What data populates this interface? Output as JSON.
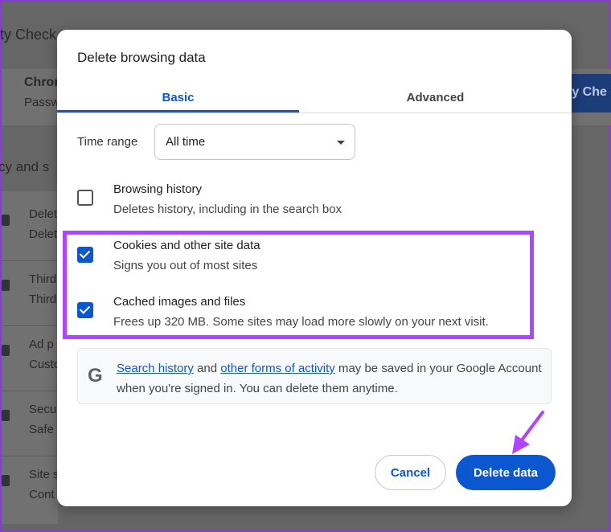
{
  "background": {
    "section_title": "ty Check",
    "safety_card_title": "Chron",
    "safety_card_sub": "Passw",
    "safety_button": "ty Che",
    "privacy_heading": "cy and s",
    "rows": [
      {
        "t": "Delet",
        "s": "Delet"
      },
      {
        "t": "Third",
        "s": "Third"
      },
      {
        "t": "Ad p",
        "s": "Custo"
      },
      {
        "t": "Secu",
        "s": "Safe"
      },
      {
        "t": "Site s",
        "s": "Cont"
      }
    ]
  },
  "dialog": {
    "title": "Delete browsing data",
    "tabs": [
      {
        "label": "Basic",
        "active": true
      },
      {
        "label": "Advanced",
        "active": false
      }
    ],
    "time_range_label": "Time range",
    "time_range_value": "All time",
    "options": [
      {
        "title": "Browsing history",
        "desc": "Deletes history, including in the search box",
        "checked": false
      },
      {
        "title": "Cookies and other site data",
        "desc": "Signs you out of most sites",
        "checked": true
      },
      {
        "title": "Cached images and files",
        "desc": "Frees up 320 MB. Some sites may load more slowly on your next visit.",
        "checked": true
      }
    ],
    "info": {
      "link1": "Search history",
      "and": " and ",
      "link2": "other forms of activity",
      "rest": " may be saved in your Google Account when you're signed in. You can delete them anytime.",
      "icon_letter": "G"
    },
    "cancel_label": "Cancel",
    "delete_label": "Delete data"
  },
  "colors": {
    "accent": "#0b57d0",
    "highlight": "#b044ff"
  }
}
